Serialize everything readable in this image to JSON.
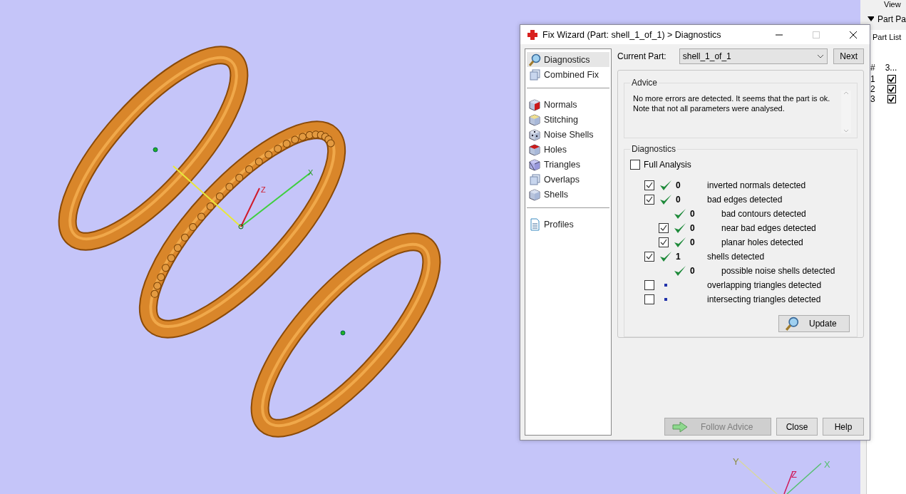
{
  "viewport": {
    "center_axis_labels": [
      "Z",
      "X"
    ],
    "corner_axis_labels": [
      "Y",
      "Z",
      "X"
    ]
  },
  "dialog": {
    "title": "Fix Wizard (Part: shell_1_of_1) > Diagnostics",
    "nav_groups": [
      [
        {
          "label": "Diagnostics",
          "kind": "magnifier",
          "selected": true
        },
        {
          "label": "Combined Fix",
          "kind": "stack",
          "selected": false
        }
      ],
      [
        {
          "label": "Normals",
          "kind": "side",
          "selected": false
        },
        {
          "label": "Stitching",
          "kind": "patch",
          "selected": false
        },
        {
          "label": "Noise Shells",
          "kind": "dice",
          "selected": false
        },
        {
          "label": "Holes",
          "kind": "top",
          "selected": false
        },
        {
          "label": "Triangles",
          "kind": "triangles",
          "selected": false
        },
        {
          "label": "Overlaps",
          "kind": "stack",
          "selected": false
        },
        {
          "label": "Shells",
          "kind": "cube",
          "selected": false
        }
      ],
      [
        {
          "label": "Profiles",
          "kind": "document",
          "selected": false
        }
      ]
    ],
    "current_part": {
      "label": "Current Part:",
      "value": "shell_1_of_1"
    },
    "next_button": "Next",
    "advice": {
      "title": "Advice",
      "text": "No more errors are detected. It seems that the part is ok.\nNote that not all parameters were analysed."
    },
    "diagnostics": {
      "title": "Diagnostics",
      "full_analysis": {
        "label": "Full Analysis",
        "checked": false
      },
      "rows": [
        {
          "checked": true,
          "kind": "ok",
          "count": "0",
          "label": "inverted normals detected"
        },
        {
          "checked": true,
          "kind": "ok",
          "count": "0",
          "label": "bad edges detected",
          "children": [
            {
              "kind": "ok",
              "count": "0",
              "label": "bad contours detected"
            },
            {
              "checked": true,
              "kind": "ok",
              "count": "0",
              "label": "near bad edges detected"
            },
            {
              "checked": true,
              "kind": "ok",
              "count": "0",
              "label": "planar holes detected"
            }
          ]
        },
        {
          "checked": true,
          "kind": "ok",
          "count": "1",
          "label": "shells detected",
          "children": [
            {
              "kind": "ok",
              "count": "0",
              "label": "possible noise shells detected"
            }
          ]
        },
        {
          "checked": false,
          "kind": "pending",
          "label": "overlapping triangles detected"
        },
        {
          "checked": false,
          "kind": "pending",
          "label": "intersecting triangles detected"
        }
      ],
      "update_button": "Update"
    },
    "buttons": [
      {
        "kind": "follow",
        "label": "Follow Advice",
        "disabled": true
      },
      {
        "kind": "plain",
        "label": "Close",
        "disabled": false
      },
      {
        "kind": "plain",
        "label": "Help",
        "disabled": false
      }
    ]
  },
  "side_panel": {
    "menu": "View",
    "section": "Part Pa",
    "tab": "Part List",
    "columns": [
      "#",
      "3..."
    ],
    "rows": [
      {
        "index": "1",
        "checked": true
      },
      {
        "index": "2",
        "checked": true
      },
      {
        "index": "3",
        "checked": true
      }
    ]
  }
}
